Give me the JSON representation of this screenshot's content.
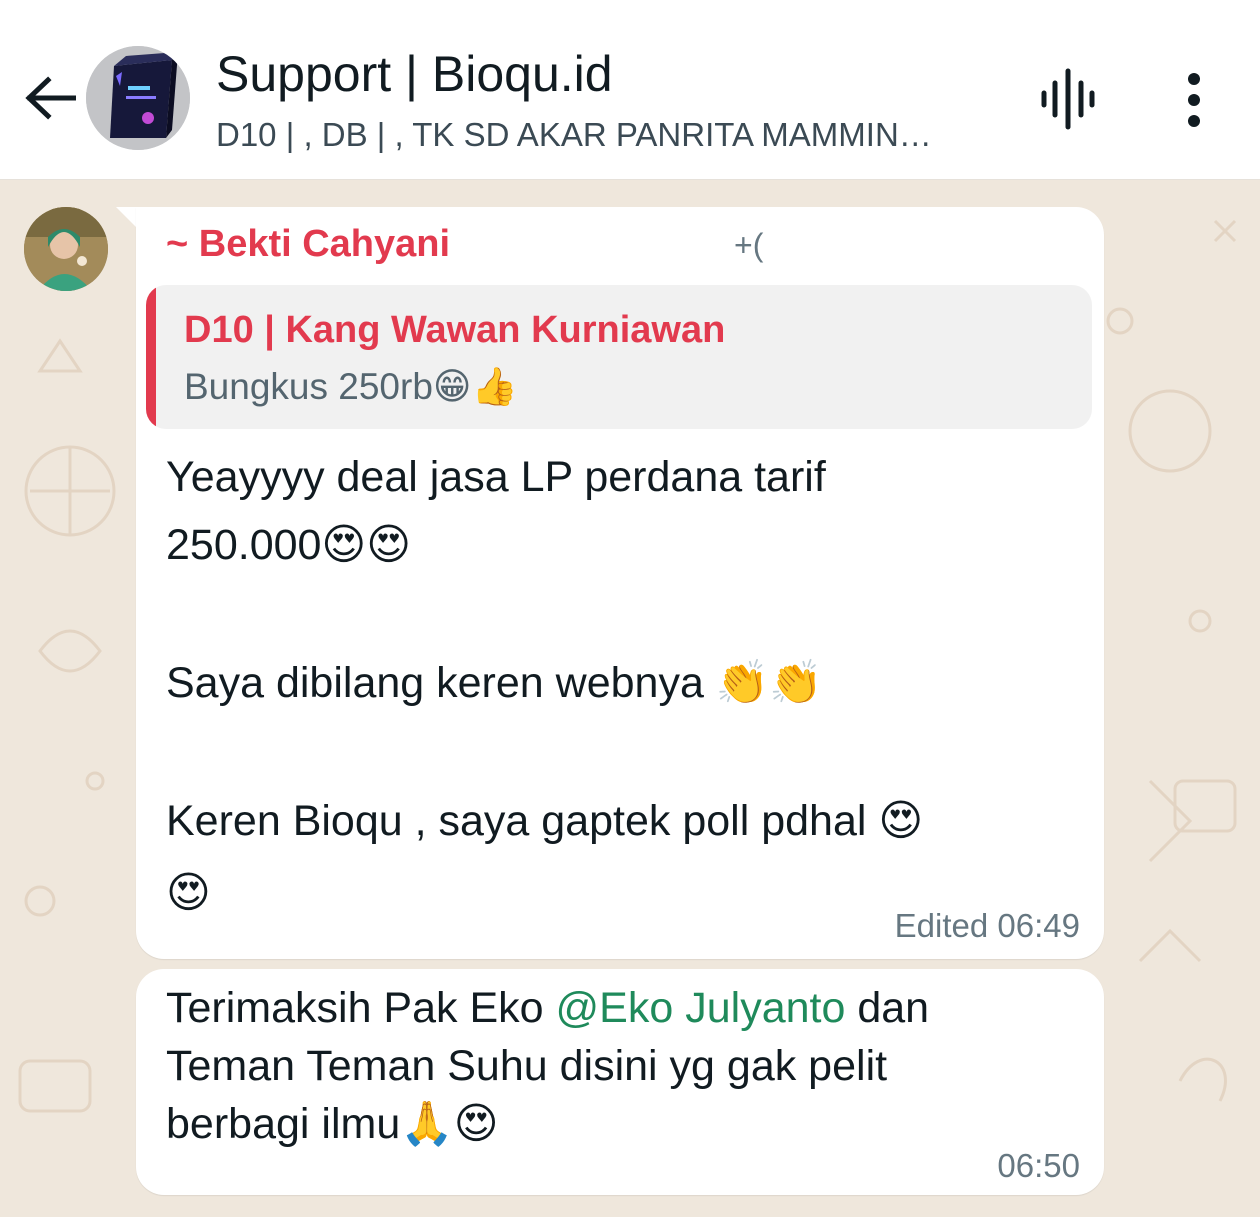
{
  "header": {
    "title": "Support | Bioqu.id",
    "subtitle": "D10 | , DB | , TK SD AKAR PANRITA MAMMIN…"
  },
  "messages": [
    {
      "sender": "~ Bekti Cahyani",
      "phone": "+(",
      "quote": {
        "author": "D10 | Kang Wawan Kurniawan",
        "text": "Bungkus 250rb😁👍"
      },
      "lines": [
        "Yeayyyy deal jasa LP perdana tarif",
        "250.000😍😍",
        "Saya dibilang keren webnya 👏👏",
        "Keren Bioqu , saya gaptek poll pdhal 😍",
        "😍"
      ],
      "meta": "Edited 06:49"
    },
    {
      "line1_before": "Terimaksih Pak Eko ",
      "mention": "@Eko Julyanto",
      "line1_after": " dan",
      "line2": "Teman Teman Suhu disini yg gak pelit",
      "line3": "berbagi ilmu🙏😍",
      "meta": "06:50"
    }
  ],
  "icons": {
    "back": "arrow-left-icon",
    "voice": "voice-chat-icon",
    "menu": "more-vertical-icon"
  },
  "colors": {
    "sender_name": "#e23a4e",
    "mention": "#1f8a5b",
    "wallpaper": "#efe7dc"
  }
}
